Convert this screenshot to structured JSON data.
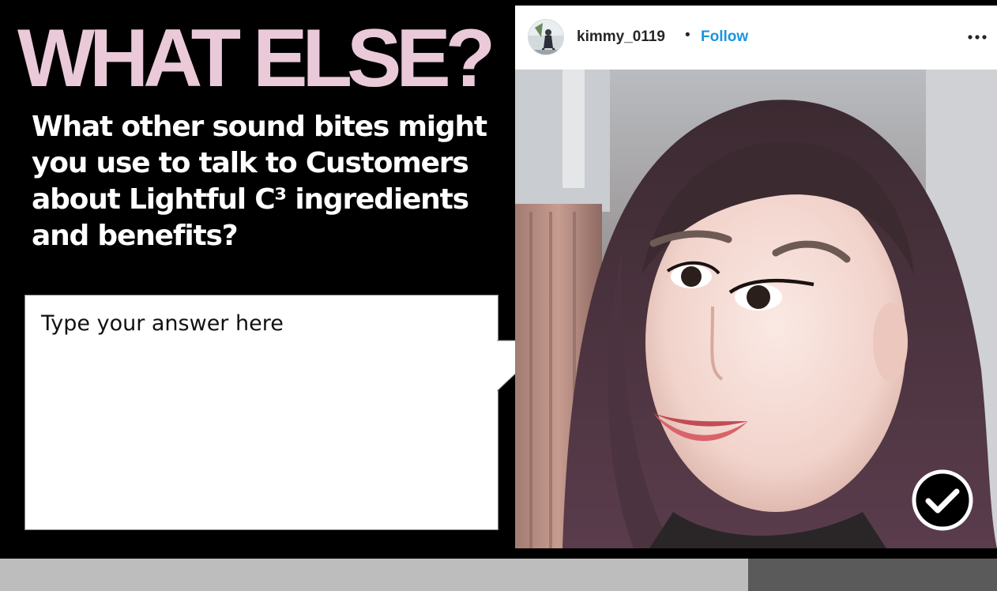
{
  "slide": {
    "headline": "WHAT ELSE?",
    "prompt": "What other sound bites might you use to talk to Customers about Lightful C³ ingredients and benefits?",
    "answer": {
      "placeholder": "Type your answer here",
      "value": ""
    }
  },
  "post": {
    "username": "kimmy_0119",
    "separator": "•",
    "follow_label": "Follow",
    "follow_color": "#1a95e0",
    "more_icon": "more-horizontal-icon",
    "submit_icon": "checkmark-circle-icon"
  },
  "colors": {
    "headline": "#eac9d8",
    "background": "#000000",
    "progress_track": "#bdbdbd",
    "progress_remaining": "#5a5a5a"
  },
  "progress": {
    "fraction": 0.75
  }
}
